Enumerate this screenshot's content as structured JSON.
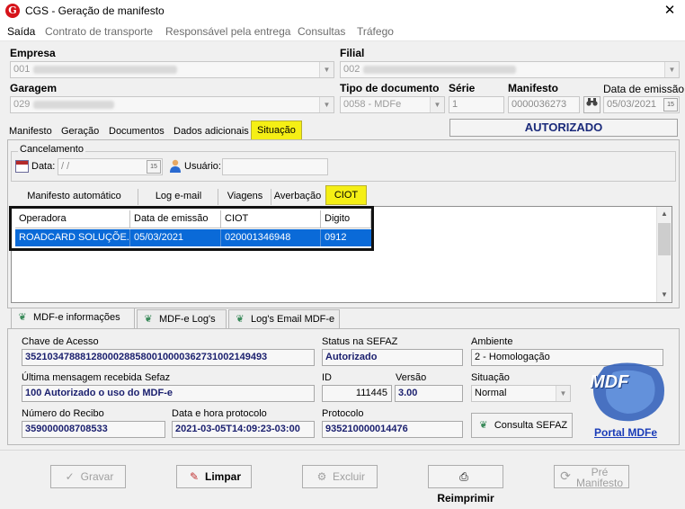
{
  "window": {
    "title": "CGS - Geração de manifesto",
    "close_glyph": "✕",
    "app_icon_letter": "G"
  },
  "menu": [
    "Saída",
    "Contrato de transporte",
    "Responsável pela entrega",
    "Consultas",
    "Tráfego"
  ],
  "fields": {
    "empresa_label": "Empresa",
    "empresa_value": "001",
    "filial_label": "Filial",
    "filial_value": "002",
    "garagem_label": "Garagem",
    "garagem_value": "029",
    "tipo_doc_label": "Tipo de documento",
    "tipo_doc_value": "0058 - MDFe",
    "serie_label": "Série",
    "serie_value": "1",
    "manifesto_label": "Manifesto",
    "manifesto_value": "0000036273",
    "data_emissao_label": "Data de emissão",
    "data_emissao_value": "05/03/2021",
    "status": "AUTORIZADO"
  },
  "tabs": [
    "Manifesto",
    "Geração",
    "Documentos",
    "Dados adicionais",
    "Situação"
  ],
  "cancelamento": {
    "title": "Cancelamento",
    "data_label": "Data:",
    "data_value": " /  /",
    "usuario_label": "Usuário:"
  },
  "subtabs": [
    "Manifesto automático",
    "Log e-mail",
    "Viagens",
    "Averbação",
    "CIOT"
  ],
  "grid": {
    "headers": [
      "Operadora",
      "Data de emissão",
      "CIOT",
      "Digito"
    ],
    "rows": [
      [
        "ROADCARD SOLUÇÕE...",
        "05/03/2021",
        "020001346948",
        "0912"
      ]
    ]
  },
  "bottom_tabs": [
    "MDF-e informações",
    "MDF-e Log's",
    "Log's Email MDF-e"
  ],
  "info": {
    "chave_label": "Chave de Acesso",
    "chave_value": "35210347888128000288580010000362731002149493",
    "status_sefaz_label": "Status na SEFAZ",
    "status_sefaz_value": "Autorizado",
    "ambiente_label": "Ambiente",
    "ambiente_value": "2 - Homologação",
    "ultima_msg_label": "Última mensagem recebida Sefaz",
    "ultima_msg_value": "100 Autorizado o uso do MDF-e",
    "id_label": "ID",
    "id_value": "111445",
    "versao_label": "Versão",
    "versao_value": "3.00",
    "situacao_label": "Situação",
    "situacao_value": "Normal",
    "recibo_label": "Número do Recibo",
    "recibo_value": "359000008708533",
    "data_protocolo_label": "Data e hora protocolo",
    "data_protocolo_value": "2021-03-05T14:09:23-03:00",
    "protocolo_label": "Protocolo",
    "protocolo_value": "935210000014476",
    "consulta_btn": "Consulta SEFAZ",
    "portal_link": "Portal MDFe",
    "logo_text": "MDF"
  },
  "actions": {
    "gravar": "Gravar",
    "limpar": "Limpar",
    "excluir": "Excluir",
    "reimprimir": "Reimprimir",
    "pre_manifesto_line1": "Pré",
    "pre_manifesto_line2": "Manifesto"
  },
  "colors": {
    "selection": "#0a6ad8",
    "highlight_tab": "#f5ef15",
    "value_text": "#1a1f6e",
    "status_text": "#1a2a7a"
  },
  "icons": [
    "app-logo-icon",
    "close-icon",
    "dropdown-arrow-icon",
    "calendar-icon",
    "user-icon",
    "search-binoculars-icon",
    "mdfe-leaf-icon",
    "check-icon",
    "eraser-icon",
    "delete-icon",
    "printer-icon",
    "refresh-icon"
  ]
}
